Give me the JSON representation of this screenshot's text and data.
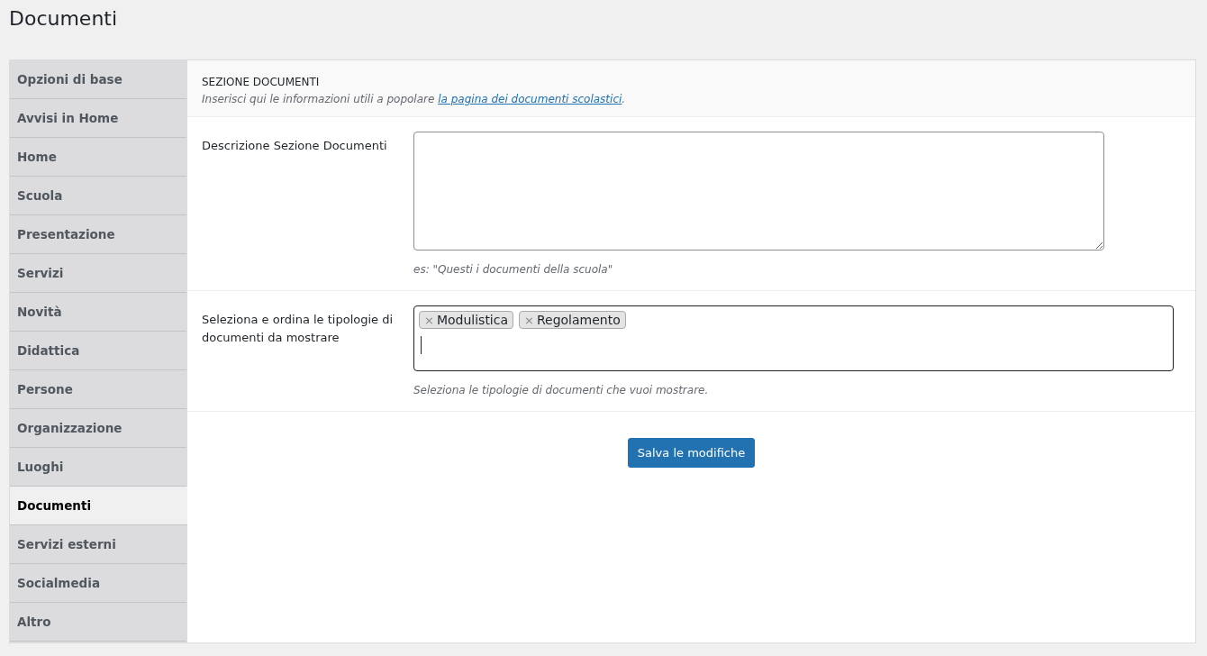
{
  "page_title": "Documenti",
  "sidebar": {
    "items": [
      {
        "label": "Opzioni di base",
        "selected": false
      },
      {
        "label": "Avvisi in Home",
        "selected": false
      },
      {
        "label": "Home",
        "selected": false
      },
      {
        "label": "Scuola",
        "selected": false
      },
      {
        "label": "Presentazione",
        "selected": false
      },
      {
        "label": "Servizi",
        "selected": false
      },
      {
        "label": "Novità",
        "selected": false
      },
      {
        "label": "Didattica",
        "selected": false
      },
      {
        "label": "Persone",
        "selected": false
      },
      {
        "label": "Organizzazione",
        "selected": false
      },
      {
        "label": "Luoghi",
        "selected": false
      },
      {
        "label": "Documenti",
        "selected": true
      },
      {
        "label": "Servizi esterni",
        "selected": false
      },
      {
        "label": "Socialmedia",
        "selected": false
      },
      {
        "label": "Altro",
        "selected": false
      }
    ]
  },
  "section": {
    "title": "SEZIONE DOCUMENTI",
    "description_before": "Inserisci qui le informazioni utili a popolare ",
    "description_link": "la pagina dei documenti scolastici",
    "description_after": "."
  },
  "fields": [
    {
      "kind": "textarea",
      "label": "Descrizione Sezione Documenti",
      "hint": "es: \"Questi i documenti della scuola\""
    },
    {
      "kind": "tags",
      "label": "Seleziona e ordina le tipologie di documenti da mostrare",
      "tags": [
        {
          "remove": "×",
          "label": "Modulistica"
        },
        {
          "remove": "×",
          "label": "Regolamento"
        }
      ],
      "hint": "Seleziona le tipologie di documenti che vuoi mostrare."
    }
  ],
  "save_button": "Salva le modifiche"
}
